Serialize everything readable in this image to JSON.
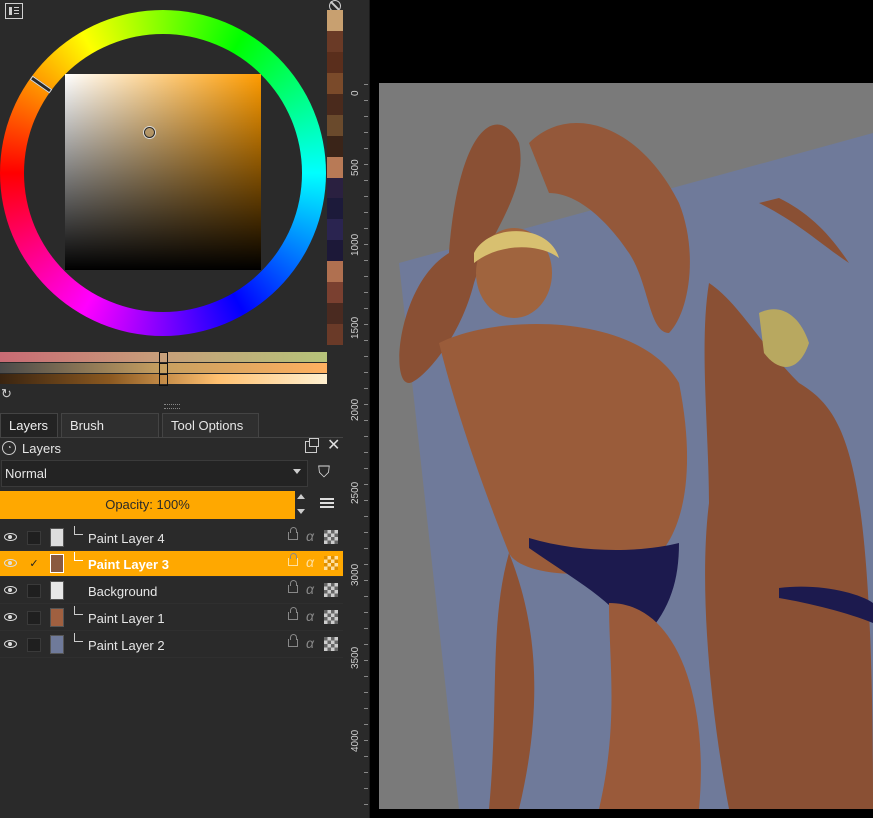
{
  "colors": {
    "accent": "#ffa800",
    "panel_bg": "#2a2a2a",
    "canvas_bg": "#000000",
    "artwork_bg": "#7a7a7a",
    "mirror_blue": "#6f7a9a",
    "skin": "#9a5a38",
    "briefs": "#1c1a4e"
  },
  "palette": [
    "#c8a070",
    "#6a3a26",
    "#5a2e1c",
    "#7a4a2a",
    "#4a2a1c",
    "#6a4a2c",
    "#3a2418",
    "#b87a56",
    "#2a2040",
    "#1c1a3a",
    "#2a2450",
    "#1c1838",
    "#b07050",
    "#7a4030",
    "#4a2a20",
    "#6a3a28"
  ],
  "tabs": [
    "Layers",
    "Brush Presets",
    "Tool Options"
  ],
  "layers_panel": {
    "title": "Layers",
    "blend_mode": "Normal",
    "opacity_label": "Opacity:  100%",
    "layers": [
      {
        "name": "Paint Layer 4",
        "active": false,
        "checked": false
      },
      {
        "name": "Paint Layer 3",
        "active": true,
        "checked": true
      },
      {
        "name": "Background",
        "active": false,
        "checked": false
      },
      {
        "name": "Paint Layer 1",
        "active": false,
        "checked": false
      },
      {
        "name": "Paint Layer 2",
        "active": false,
        "checked": false
      }
    ]
  },
  "ruler": {
    "labels": [
      "0",
      "500",
      "1000",
      "1500",
      "2000",
      "2500",
      "3000",
      "3500",
      "4000"
    ]
  },
  "icons": {
    "docker_menu": "docker-menu-icon",
    "palette_reset": "no-entry-icon",
    "refresh": "refresh-icon",
    "float": "float-panel-icon",
    "close": "close-icon",
    "filter": "filter-icon",
    "menu": "hamburger-icon",
    "eye": "eye-icon",
    "lock": "lock-icon",
    "alpha": "alpha-lock-icon",
    "inherit": "inherit-alpha-icon"
  },
  "glyphs": {
    "close": "✕",
    "filter": "⛉",
    "refresh": "↻",
    "check": "✓",
    "alpha": "α",
    "lock_circle": "◔"
  }
}
